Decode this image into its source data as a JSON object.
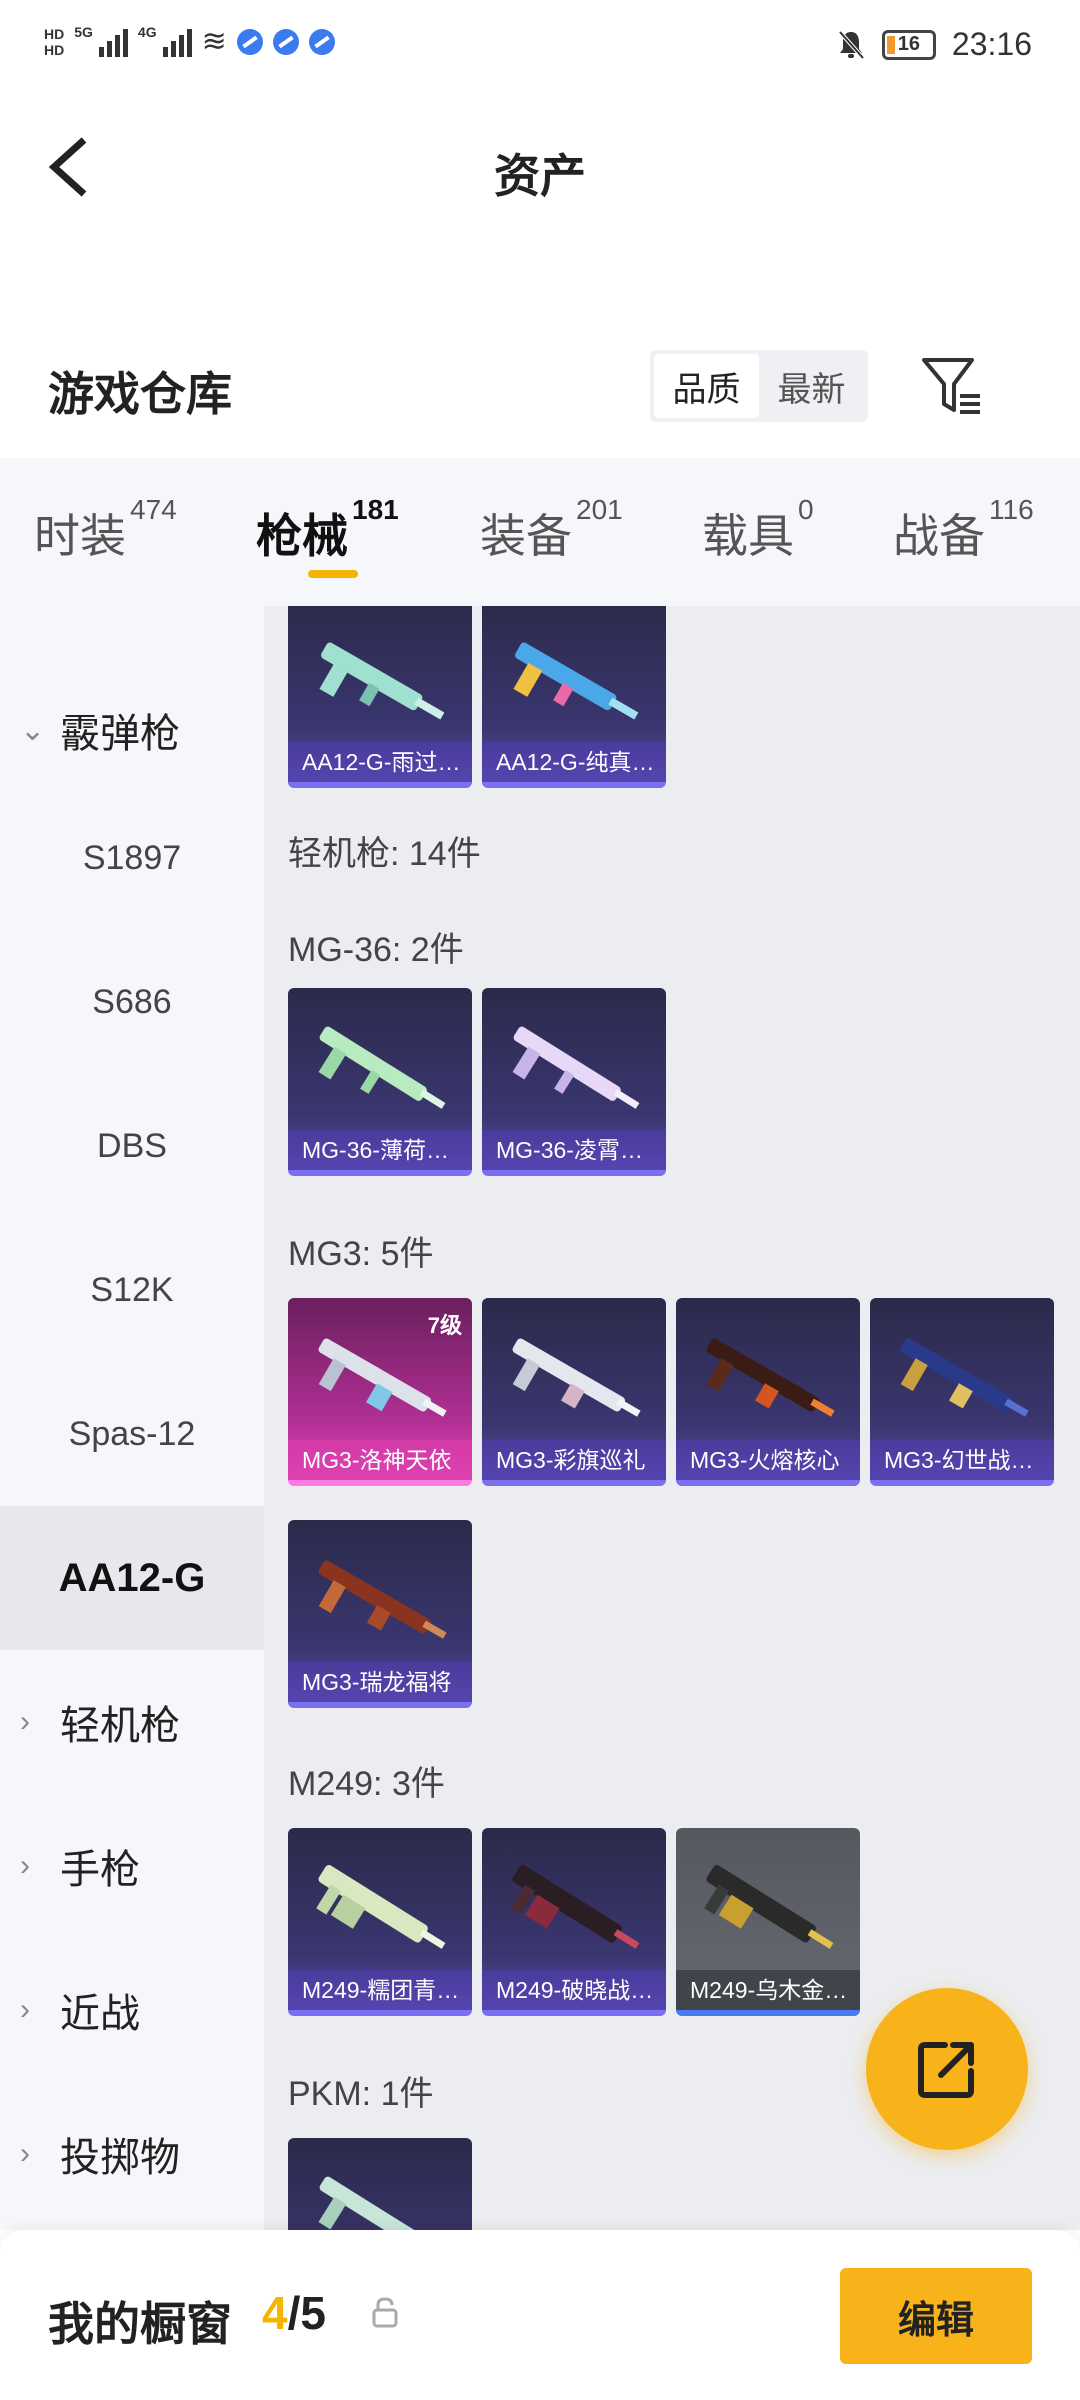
{
  "status_bar": {
    "net_type_1": "5G",
    "net_type_2": "4G",
    "battery": "16",
    "time": "23:16"
  },
  "header": {
    "title": "资产",
    "back_icon": "chevron-left-icon"
  },
  "warehouse": {
    "title": "游戏仓库",
    "sort_options": [
      "品质",
      "最新"
    ],
    "sort_selected": "品质",
    "filter_icon": "filter-icon"
  },
  "tabs": [
    {
      "label": "时装",
      "count": "474"
    },
    {
      "label": "枪械",
      "count": "181"
    },
    {
      "label": "装备",
      "count": "201"
    },
    {
      "label": "载具",
      "count": "0"
    },
    {
      "label": "战备",
      "count": "116"
    }
  ],
  "tabs_active": "枪械",
  "sidenav": {
    "group_shotgun": "霰弹枪",
    "items": [
      "S1897",
      "S686",
      "DBS",
      "S12K",
      "Spas-12",
      "AA12-G"
    ],
    "selected": "AA12-G",
    "groups": [
      "轻机枪",
      "手枪",
      "近战",
      "投掷物"
    ]
  },
  "content": {
    "aa12_cards": [
      "AA12-G-雨过…",
      "AA12-G-纯真…"
    ],
    "lmg_section": "轻机枪: 14件",
    "mg36_section": "MG-36: 2件",
    "mg36_cards": [
      "MG-36-薄荷…",
      "MG-36-凌霄…"
    ],
    "mg3_section": "MG3: 5件",
    "mg3_cards": [
      "MG3-洛神天依",
      "MG3-彩旗巡礼",
      "MG3-火熔核心",
      "MG3-幻世战…",
      "MG3-瑞龙福将"
    ],
    "mg3_level": "7级",
    "m249_section": "M249: 3件",
    "m249_cards": [
      "M249-糯团青…",
      "M249-破晓战…",
      "M249-乌木金…"
    ],
    "pkm_section": "PKM: 1件"
  },
  "bottom_bar": {
    "title": "我的橱窗",
    "count_current": "4",
    "count_sep": "/5",
    "edit_label": "编辑"
  },
  "colors": {
    "accent": "#f8b21a",
    "tab_underline": "#f5b400",
    "card_purple": "#3a3670",
    "card_magenta": "#b43096"
  }
}
